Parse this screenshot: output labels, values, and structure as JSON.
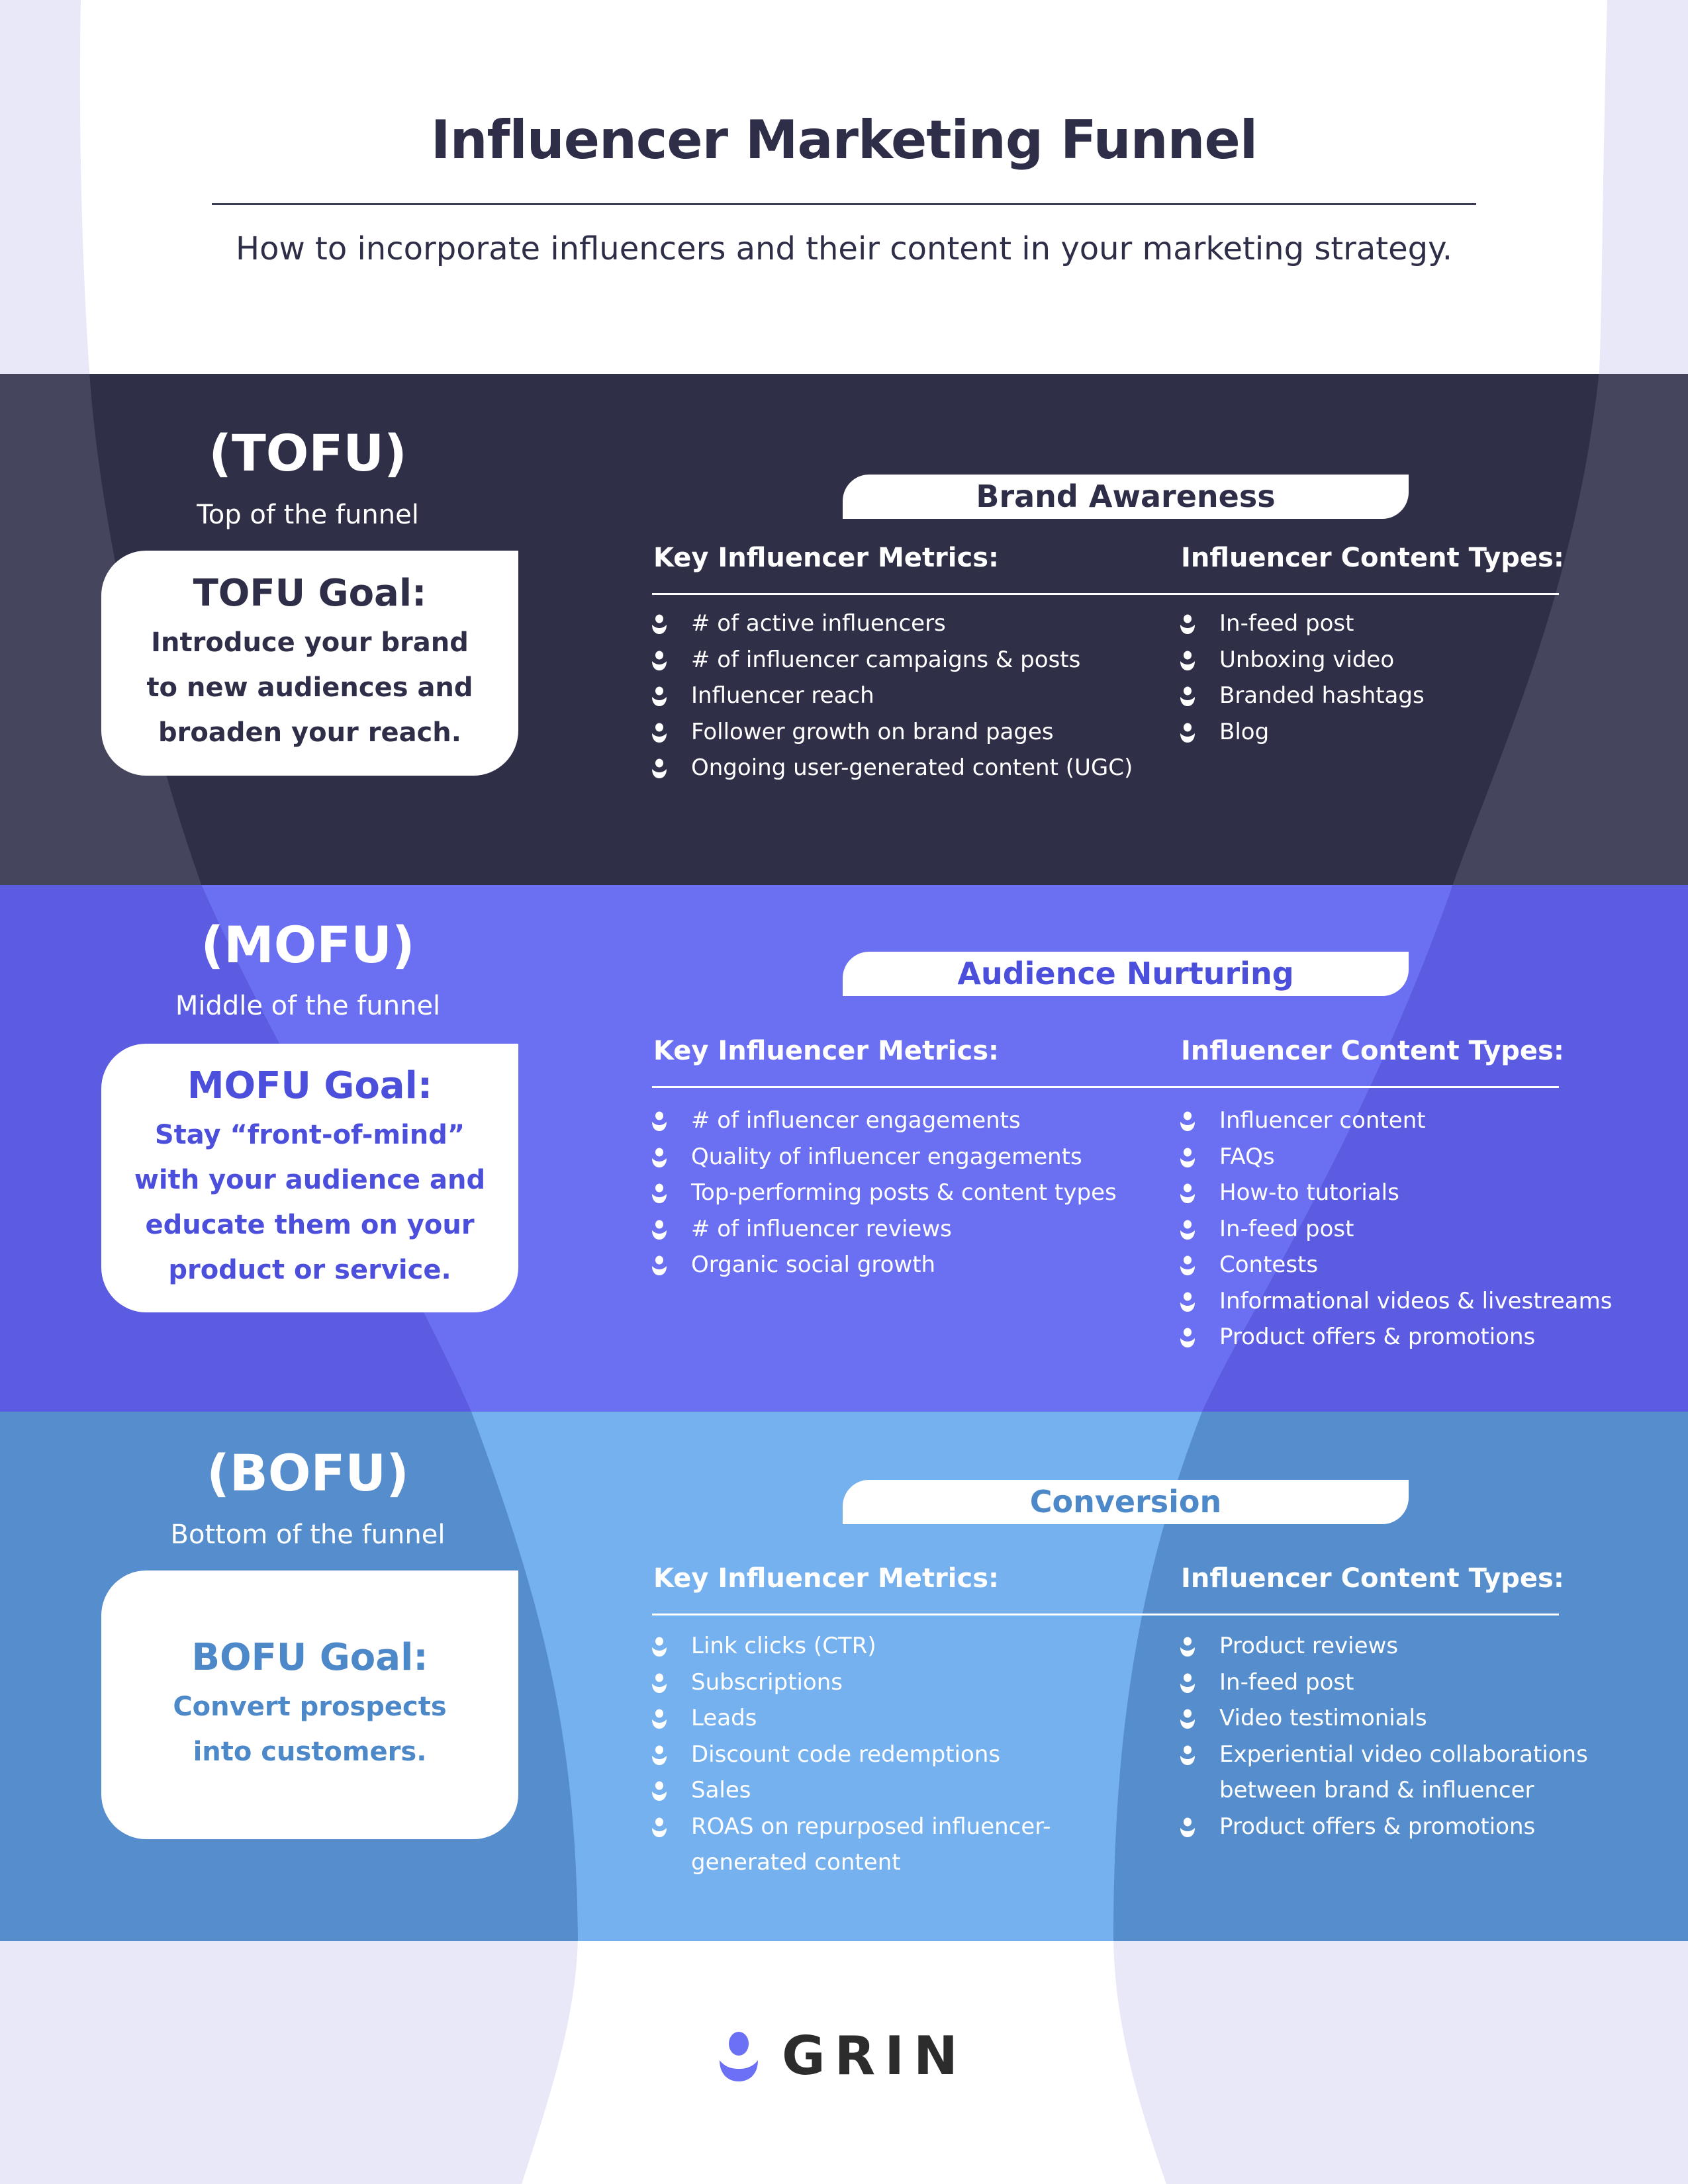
{
  "header": {
    "title": "Influencer Marketing Funnel",
    "subtitle": "How to incorporate influencers and their content in your marketing strategy."
  },
  "colors": {
    "page_bg": "#e9e8f8",
    "funnel_white": "#ffffff",
    "tofu_outer": "#45455e",
    "tofu_inner": "#2f2f47",
    "mofu_outer": "#5b5ce1",
    "mofu_inner": "#6b70f2",
    "bofu_outer": "#568dcc",
    "bofu_inner": "#75b0ef",
    "title_text": "#2e2e48",
    "logo_accent": "#6b70f5"
  },
  "columns": {
    "metrics_heading": "Key Influencer Metrics:",
    "content_heading": "Influencer Content Types:"
  },
  "stages": [
    {
      "abbr": "(TOFU)",
      "name": "Top of the funnel",
      "goal_title": "TOFU Goal:",
      "goal_lines": [
        "Introduce your brand",
        "to new audiences and",
        "broaden your reach."
      ],
      "goal_color": "#2e2e48",
      "tab_label": "Brand Awareness",
      "tab_color": "#2e2e48",
      "metrics": [
        "# of active influencers",
        "# of influencer campaigns & posts",
        "Influencer reach",
        "Follower growth on brand pages",
        "Ongoing user-generated content (UGC)"
      ],
      "content_types": [
        "In-feed post",
        "Unboxing video",
        "Branded hashtags",
        "Blog"
      ]
    },
    {
      "abbr": "(MOFU)",
      "name": "Middle of the funnel",
      "goal_title": "MOFU Goal:",
      "goal_lines": [
        "Stay “front-of-mind”",
        "with your audience and",
        "educate them on your",
        "product or service."
      ],
      "goal_color": "#4b4fdc",
      "tab_label": "Audience Nurturing",
      "tab_color": "#4b4fdc",
      "metrics": [
        "# of influencer engagements",
        "Quality of influencer engagements",
        "Top-performing posts & content types",
        "# of influencer reviews",
        "Organic social growth"
      ],
      "content_types": [
        "Influencer content",
        "FAQs",
        "How-to tutorials",
        "In-feed post",
        "Contests",
        "Informational videos & livestreams",
        "Product offers & promotions"
      ]
    },
    {
      "abbr": "(BOFU)",
      "name": "Bottom of the funnel",
      "goal_title": "BOFU Goal:",
      "goal_lines": [
        "Convert prospects",
        "into customers."
      ],
      "goal_color": "#4d88c9",
      "tab_label": "Conversion",
      "tab_color": "#4d88c9",
      "metrics": [
        "Link clicks (CTR)",
        "Subscriptions",
        "Leads",
        "Discount code redemptions",
        "Sales",
        "ROAS on repurposed influencer-generated content"
      ],
      "content_types": [
        "Product reviews",
        "In-feed post",
        "Video testimonials",
        "Experiential video collaborations between brand & influencer",
        "Product offers & promotions"
      ]
    }
  ],
  "footer": {
    "logo_text": "GRIN",
    "logo_icon": "grin-smile-icon"
  }
}
